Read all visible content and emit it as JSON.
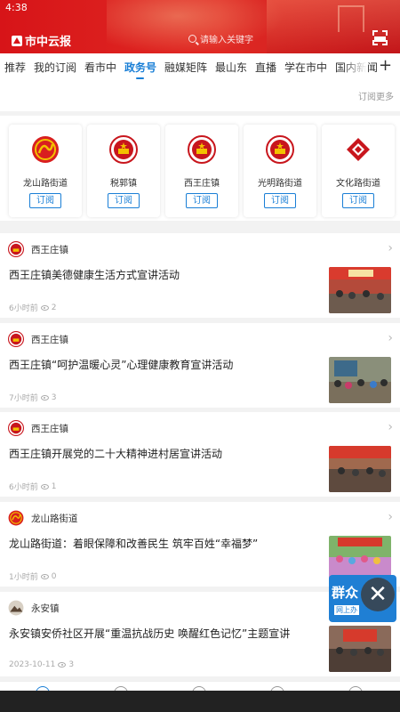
{
  "status": {
    "time": "4:38"
  },
  "header": {
    "app_name": "市中云报",
    "search_placeholder": "请输入关键字"
  },
  "tabs": [
    "推荐",
    "我的订阅",
    "看市中",
    "政务号",
    "融媒矩阵",
    "最山东",
    "直播",
    "学在市中",
    "国内新闻"
  ],
  "active_tab": "政务号",
  "subscribe_more": "订阅更多",
  "accounts": [
    {
      "name": "龙山路街道",
      "button": "订阅",
      "icon": "longshan-logo-icon"
    },
    {
      "name": "税郭镇",
      "button": "订阅",
      "icon": "national-emblem-icon"
    },
    {
      "name": "西王庄镇",
      "button": "订阅",
      "icon": "national-emblem-icon"
    },
    {
      "name": "光明路街道",
      "button": "订阅",
      "icon": "national-emblem-icon"
    },
    {
      "name": "文化路街道",
      "button": "订阅",
      "icon": "wenhua-logo-icon"
    }
  ],
  "feed": [
    {
      "source": "西王庄镇",
      "title": "西王庄镇美德健康生活方式宣讲活动",
      "time": "6小时前",
      "views": "2",
      "icon": "national-emblem-icon"
    },
    {
      "source": "西王庄镇",
      "title": "西王庄镇“呵护温暖心灵”心理健康教育宣讲活动",
      "time": "7小时前",
      "views": "3",
      "icon": "national-emblem-icon"
    },
    {
      "source": "西王庄镇",
      "title": "西王庄镇开展党的二十大精神进村居宣讲活动",
      "time": "6小时前",
      "views": "1",
      "icon": "national-emblem-icon"
    },
    {
      "source": "龙山路街道",
      "title": "龙山路街道：着眼保障和改善民生  筑牢百姓“幸福梦”",
      "time": "1小时前",
      "views": "0",
      "icon": "longshan-logo-icon"
    },
    {
      "source": "永安镇",
      "title": "永安镇安侨社区开展“重温抗战历史  唤醒红色记忆”主题宣讲",
      "time": "2023-10-11",
      "views": "3",
      "icon": "mountain-photo-icon"
    }
  ],
  "floating_badge": {
    "main": "群众",
    "sub": "网上办"
  },
  "colors": {
    "accent": "#1a7fd6",
    "header_red": "#d71418"
  }
}
